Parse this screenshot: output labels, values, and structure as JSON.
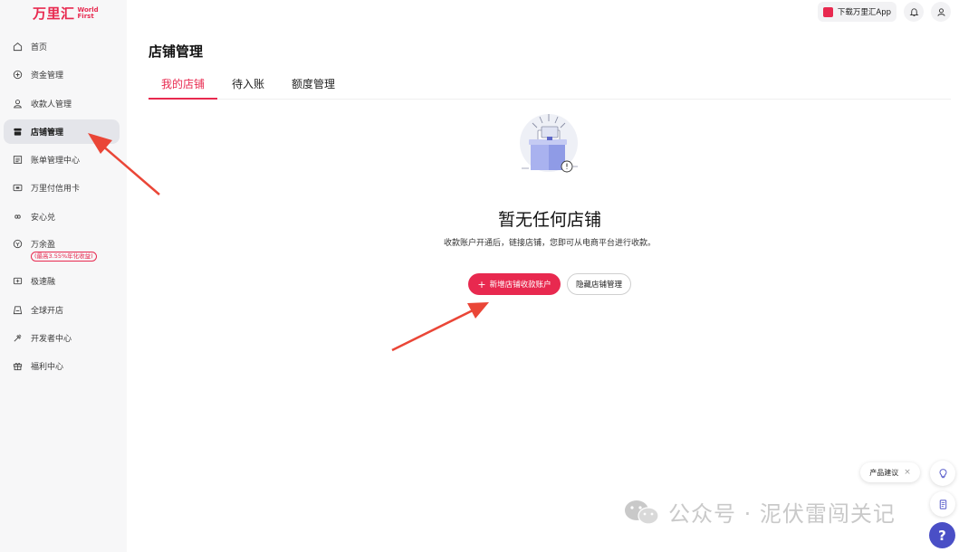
{
  "brand": {
    "name_cn": "万里汇",
    "name_en": "World First"
  },
  "header": {
    "app_download": "下载万里汇App"
  },
  "sidebar": {
    "items": [
      {
        "label": "首页",
        "icon": "home-icon"
      },
      {
        "label": "资金管理",
        "icon": "fund-icon"
      },
      {
        "label": "收款人管理",
        "icon": "payee-icon"
      },
      {
        "label": "店铺管理",
        "icon": "store-icon",
        "active": true
      },
      {
        "label": "账单管理中心",
        "icon": "bill-icon"
      },
      {
        "label": "万里付信用卡",
        "icon": "card-icon"
      },
      {
        "label": "安心兑",
        "icon": "exchange-icon"
      },
      {
        "label": "万余盈",
        "icon": "savings-icon",
        "badge": "(最高3.55%年化收益)"
      },
      {
        "label": "极速融",
        "icon": "finance-icon"
      },
      {
        "label": "全球开店",
        "icon": "global-store-icon"
      },
      {
        "label": "开发者中心",
        "icon": "developer-icon"
      },
      {
        "label": "福利中心",
        "icon": "gift-icon"
      }
    ]
  },
  "page": {
    "title": "店铺管理",
    "tabs": [
      {
        "label": "我的店铺",
        "active": true
      },
      {
        "label": "待入账"
      },
      {
        "label": "额度管理"
      }
    ]
  },
  "empty_state": {
    "title": "暂无任何店铺",
    "description": "收款账户开通后，链接店铺，您即可从电商平台进行收款。",
    "primary_button": "新增店铺收款账户",
    "secondary_button": "隐藏店铺管理"
  },
  "feedback": {
    "label": "产品建议",
    "help": "?"
  },
  "watermark": "公众号 · 泥伏雷闯关记",
  "colors": {
    "accent": "#e8294f",
    "help": "#4a4fc6",
    "sidebar_bg": "#f7f7f8"
  }
}
